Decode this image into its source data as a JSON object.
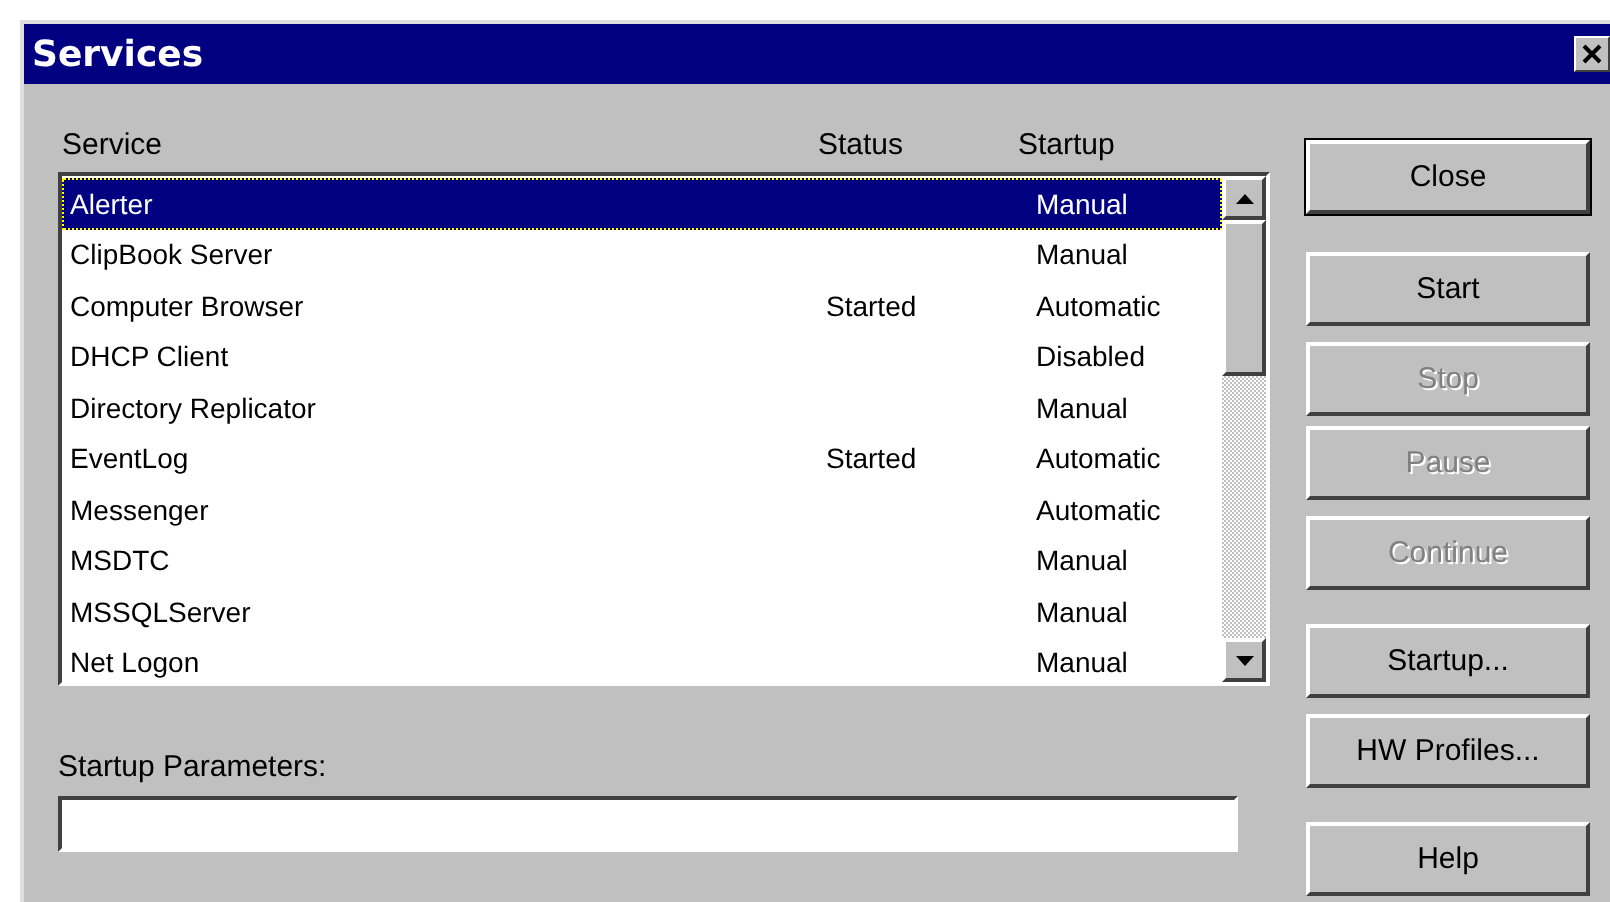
{
  "window": {
    "title": "Services"
  },
  "columns": [
    "Service",
    "Status",
    "Startup"
  ],
  "rows": [
    {
      "service": "Alerter",
      "status": "",
      "startup": "Manual",
      "selected": true
    },
    {
      "service": "ClipBook Server",
      "status": "",
      "startup": "Manual",
      "selected": false
    },
    {
      "service": "Computer Browser",
      "status": "Started",
      "startup": "Automatic",
      "selected": false
    },
    {
      "service": "DHCP Client",
      "status": "",
      "startup": "Disabled",
      "selected": false
    },
    {
      "service": "Directory Replicator",
      "status": "",
      "startup": "Manual",
      "selected": false
    },
    {
      "service": "EventLog",
      "status": "Started",
      "startup": "Automatic",
      "selected": false
    },
    {
      "service": "Messenger",
      "status": "",
      "startup": "Automatic",
      "selected": false
    },
    {
      "service": "MSDTC",
      "status": "",
      "startup": "Manual",
      "selected": false
    },
    {
      "service": "MSSQLServer",
      "status": "",
      "startup": "Manual",
      "selected": false
    },
    {
      "service": "Net Logon",
      "status": "",
      "startup": "Manual",
      "selected": false
    }
  ],
  "parameters": {
    "label": "Startup Parameters:"
  },
  "buttons": [
    {
      "label": "Close",
      "disabled": false,
      "default": true
    },
    {
      "label": "Start",
      "disabled": false,
      "default": false
    },
    {
      "label": "Stop",
      "disabled": true,
      "default": false
    },
    {
      "label": "Pause",
      "disabled": true,
      "default": false
    },
    {
      "label": "Continue",
      "disabled": true,
      "default": false
    },
    {
      "label": "Startup...",
      "disabled": false,
      "default": false
    },
    {
      "label": "HW Profiles...",
      "disabled": false,
      "default": false
    },
    {
      "label": "Help",
      "disabled": false,
      "default": false
    }
  ]
}
